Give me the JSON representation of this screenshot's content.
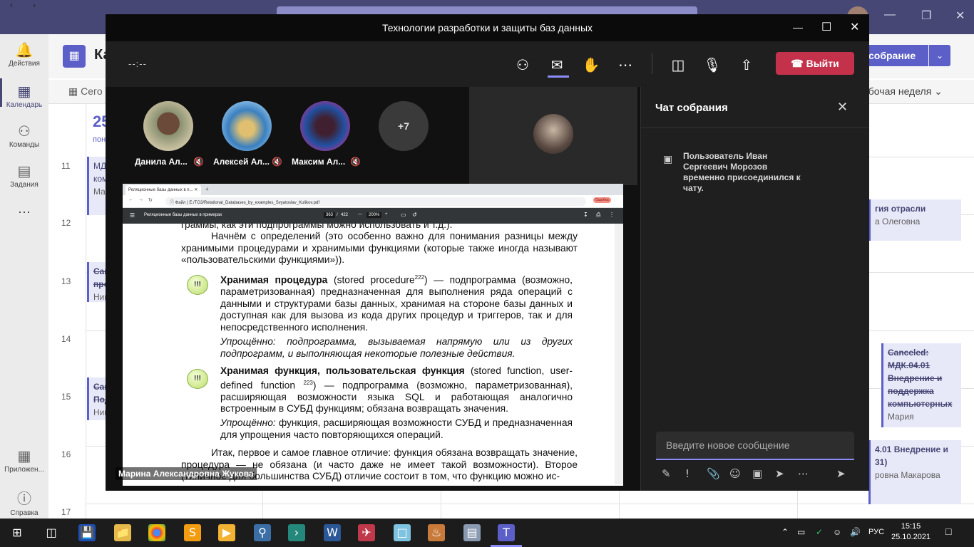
{
  "teams": {
    "rail": [
      {
        "label": "Действия",
        "icon": "bell-icon"
      },
      {
        "label": "Календарь",
        "icon": "calendar-icon"
      },
      {
        "label": "Команды",
        "icon": "teams-icon"
      },
      {
        "label": "Задания",
        "icon": "assignments-icon"
      },
      {
        "label": "Приложен...",
        "icon": "apps-icon"
      },
      {
        "label": "Справка",
        "icon": "help-icon"
      }
    ],
    "cal_title": "Ка",
    "meet_now": "собрание",
    "today": "Сего",
    "week": "абочая неделя",
    "day_num": "25",
    "day_name": "пон",
    "hours": [
      "11",
      "12",
      "13",
      "14",
      "15",
      "16",
      "17"
    ],
    "events_left": [
      {
        "title": "МДК",
        "line2": "ком",
        "people": "Мар"
      },
      {
        "title": "Canc",
        "line2": "прог",
        "people": "Ник"
      },
      {
        "title": "Canc",
        "line2": "Под",
        "people": "Ник"
      }
    ],
    "events_right": [
      {
        "title": "гия отрасли",
        "people": "а Олеговна"
      },
      {
        "title": "Canceled: МДК.04.01 Внедрение и поддержка компьютерных",
        "people": "Мария"
      },
      {
        "title": "4.01 Внедрение и",
        "line2": "31)",
        "people": "ровна Макарова"
      }
    ]
  },
  "meeting": {
    "window_title": "Технологии разработки и защиты баз данных",
    "timer": "--:--",
    "leave_label": "Выйти",
    "participants": [
      {
        "name": "Данила Ал..."
      },
      {
        "name": "Алексей Ал..."
      },
      {
        "name": "Максим Ал..."
      }
    ],
    "more_count": "+7",
    "speaker": "Марина Александровна Жукова"
  },
  "browser": {
    "tab_title": "Реляционные базы данных в п...",
    "url_prefix": "Файл",
    "url": "E:/TG3/Relational_Databases_by_examples_Svyatoslav_Kulikov.pdf",
    "pdf_title": "Реляционные базы данных в примерах",
    "page_current": "363",
    "page_total": "422",
    "zoom": "200%",
    "error_badge": "Ошибка"
  },
  "pdf": {
    "line_top": "граммы, как эти подпрограммы можно использовать и т.д.).",
    "p1": "Начнём с определений (это особенно важно для понимания разницы между хранимыми процедурами и хранимыми функциями (которые также иногда называют «пользовательскими функциями»)).",
    "bang": "!!!",
    "def1_term": "Хранимая процедура",
    "def1_sup": "222",
    "def1_pre": "(stored procedure",
    "def1_text": ") — подпрограмма (возможно, параметризованная) предназначенная для выполнения ряда операций с данными и структурами базы данных, хранимая на стороне базы данных и доступная как для вызова из кода других процедур и триггеров, так и для непосредственного исполнения.",
    "simp1": "Упрощённо: подпрограмма, вызываемая напрямую или из других подпрограмм, и выполняющая некоторые полезные действия.",
    "def2_term": "Хранимая функция, пользовательская функция",
    "def2_pre": "(stored function, user-defined function",
    "def2_sup": "223",
    "def2_text": ") — подпрограмма (возможно, параметризованная), расширяющая возможности языка SQL и работающая аналогично встроенным в СУБД функциям; обязана возвращать значения.",
    "simp2_lead": "Упрощённо:",
    "simp2": "функция, расширяющая возможности СУБД и предназначенная для упрощения часто повторяющихся операций.",
    "p2": "Итак, первое и самое главное отличие: функция обязана возвращать значение, процедура — не обязана (и часто даже не имеет такой возможности). Второе (типичное для большинства СУБД) отличие состоит в том, что функцию можно ис-"
  },
  "chat": {
    "title": "Чат собрания",
    "system_message": "Пользователь Иван Сергеевич Морозов временно присоединился к чату.",
    "input_placeholder": "Введите новое сообщение"
  },
  "taskbar": {
    "time": "15:15",
    "date": "25.10.2021",
    "lang": "РУС"
  },
  "colors": {
    "teams_purple": "#464775",
    "accent": "#5b5fc7",
    "leave_red": "#c4314b"
  }
}
